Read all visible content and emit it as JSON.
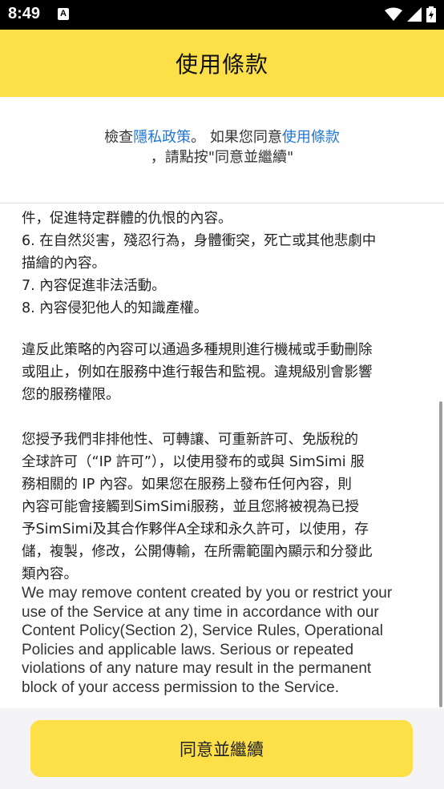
{
  "status_bar": {
    "time": "8:49",
    "notification_glyph": "A"
  },
  "header": {
    "title": "使用條款"
  },
  "notice": {
    "prefix": "檢查",
    "privacy_link": "隱私政策",
    "middle": "。 如果您同意",
    "terms_link": "使用條款",
    "line2": "，請點按\"同意並繼續\""
  },
  "content": {
    "list_lines": [
      "件，促進特定群體的仇恨的內容。",
      "6. 在自然災害，殘忍行為，身體衝突，死亡或其他悲劇中",
      "描繪的內容。",
      "7. 內容促進非法活動。",
      "8. 內容侵犯他人的知識產權。"
    ],
    "violation_lines": [
      "違反此策略的內容可以通過多種規則進行機械或手動刪除",
      "或阻止，例如在服務中進行報告和監視。違規級別會影響",
      "您的服務權限。"
    ],
    "license_lines": [
      "您授予我們非排他性、可轉讓、可重新許可、免版稅的",
      "全球許可（“IP 許可”），以使用發布的或與 SimSimi 服",
      "務相關的 IP 內容。如果您在服務上發布任何內容，則",
      "內容可能會接觸到SimSimi服務，並且您將被視為已授",
      "予SimSimi及其合作夥伴A全球和永久許可，以使用，存",
      "儲，複製，修改，公開傳輸，在所需範圍內顯示和分發此",
      "類內容。"
    ],
    "english_lines": [
      "We may remove content created by you or restrict your",
      "use of the Service at any time in accordance with our",
      "Content Policy(Section 2), Service Rules, Operational",
      "Policies and applicable laws. Serious or repeated",
      "violations of any nature may result in the permanent",
      "block of your access permission to the Service."
    ]
  },
  "footer": {
    "agree_button": "同意並繼續"
  },
  "colors": {
    "accent": "#fde047",
    "link": "#1f76d3"
  }
}
